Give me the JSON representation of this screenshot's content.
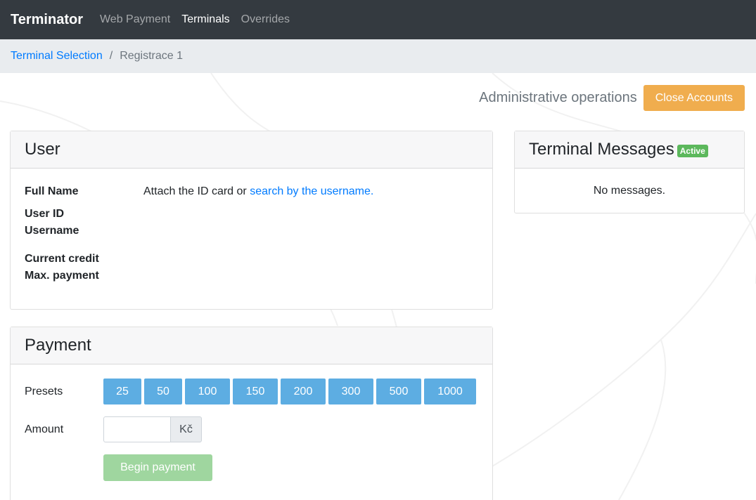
{
  "navbar": {
    "brand": "Terminator",
    "links": [
      {
        "label": "Web Payment",
        "active": false
      },
      {
        "label": "Terminals",
        "active": true
      },
      {
        "label": "Overrides",
        "active": false
      }
    ]
  },
  "breadcrumb": {
    "link": "Terminal Selection",
    "separator": "/",
    "current": "Registrace 1"
  },
  "admin": {
    "label": "Administrative operations",
    "close_accounts_label": "Close Accounts"
  },
  "user_card": {
    "title": "User",
    "full_name_label": "Full Name",
    "user_id_label": "User ID",
    "username_label": "Username",
    "current_credit_label": "Current credit",
    "max_payment_label": "Max. payment",
    "attach_text": "Attach the ID card or ",
    "search_link": "search by the username."
  },
  "messages_card": {
    "title": "Terminal Messages",
    "badge": "Active",
    "empty_text": "No messages."
  },
  "payment_card": {
    "title": "Payment",
    "presets_label": "Presets",
    "presets": [
      "25",
      "50",
      "100",
      "150",
      "200",
      "300",
      "500",
      "1000"
    ],
    "amount_label": "Amount",
    "amount_value": "",
    "currency": "Kč",
    "begin_label": "Begin payment"
  },
  "colors": {
    "navbar_bg": "#343a40",
    "link": "#007bff",
    "warning": "#f0ad4e",
    "preset": "#5dade2",
    "success_disabled": "#9fd69f",
    "badge_success": "#5cb85c"
  }
}
